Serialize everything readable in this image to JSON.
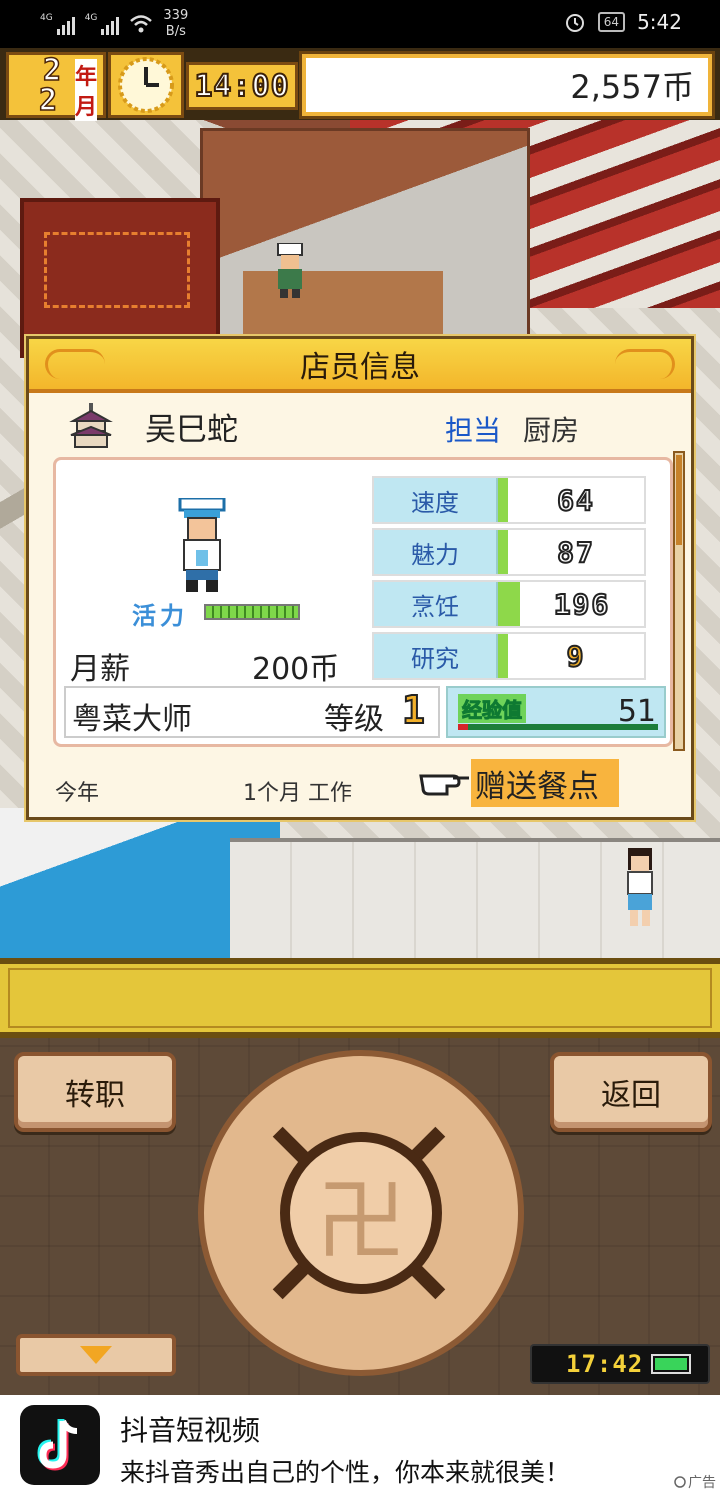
{
  "status_bar": {
    "signal1_label": "4G",
    "signal2_label": "4G",
    "net_speed_value": "339",
    "net_speed_unit": "B/s",
    "battery_level": "64",
    "time": "5:42"
  },
  "hud": {
    "year_num": "2",
    "year_unit": "年",
    "month_num": "2",
    "month_unit": "月",
    "game_time": "14:00",
    "money": "2,557币"
  },
  "dialog": {
    "title": "店员信息",
    "staff_name": "吴巳蛇",
    "dept_label": "担当",
    "dept_value": "厨房",
    "vitality_label": "活力",
    "vitality_level": 1.0,
    "salary_label": "月薪",
    "salary_value": "200币",
    "stats": [
      {
        "name": "速度",
        "value": "64"
      },
      {
        "name": "魅力",
        "value": "87"
      },
      {
        "name": "烹饪",
        "value": "196"
      },
      {
        "name": "研究",
        "value": "9"
      }
    ],
    "job_title": "粤菜大师",
    "level_label": "等级",
    "level_value": "1",
    "exp_label": "经验值",
    "exp_value": "51",
    "exp_progress": 0.05,
    "footer_left": "今年",
    "footer_mid": "1个月 工作",
    "gift_label": "赠送餐点"
  },
  "controls": {
    "left_button": "转职",
    "right_button": "返回",
    "clock": "17:42"
  },
  "ad": {
    "title": "抖音短视频",
    "subtitle": "来抖音秀出自己的个性，你本来就很美！",
    "tag": "广告"
  },
  "colors": {
    "header_gold": "#f3b62b",
    "stat_label_bg": "#bfe7f2",
    "dept_blue": "#1a58c8",
    "gift_orange": "#f8b43e"
  }
}
